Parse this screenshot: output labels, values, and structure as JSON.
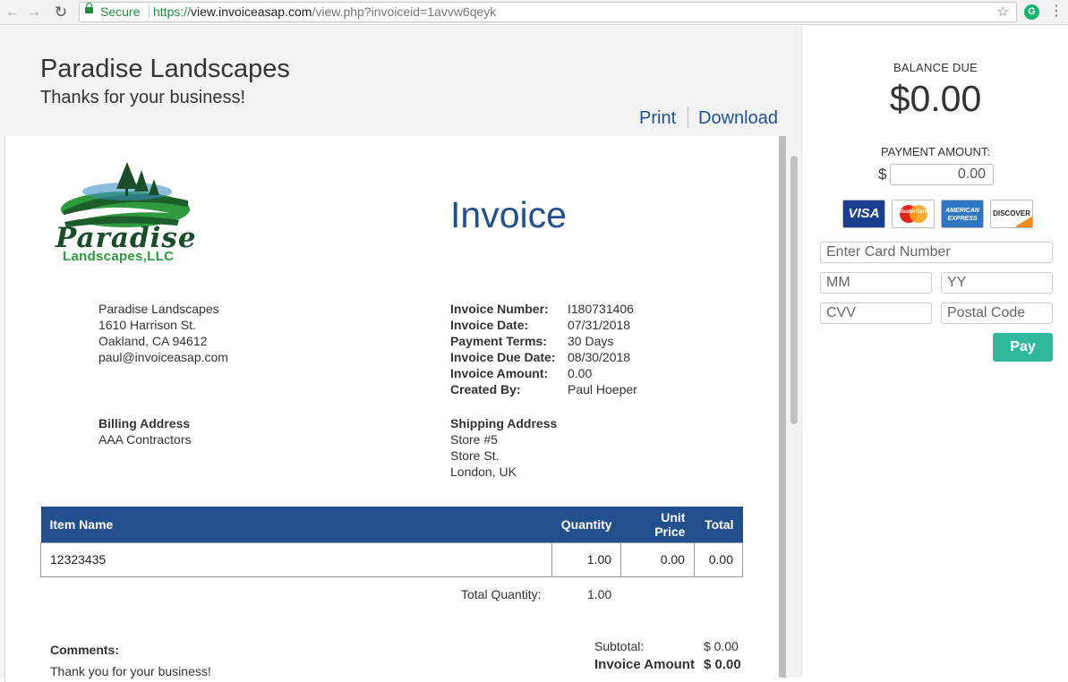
{
  "browser": {
    "secure_label": "Secure",
    "url_scheme": "https://",
    "url_host": "view.invoiceasap.com",
    "url_path": "/view.php?invoiceid=1avvw6qeyk",
    "extension_letter": "G"
  },
  "header": {
    "business_name": "Paradise Landscapes",
    "thanks": "Thanks for your business!",
    "print_label": "Print",
    "download_label": "Download"
  },
  "logo": {
    "line1": "Paradise",
    "line2": "Landscapes,LLC"
  },
  "invoice": {
    "title": "Invoice",
    "from": [
      "Paradise Landscapes",
      "1610 Harrison St.",
      "Oakland, CA 94612",
      "paul@invoiceasap.com"
    ],
    "meta": [
      {
        "label": "Invoice Number:",
        "value": "I180731406"
      },
      {
        "label": "Invoice Date:",
        "value": "07/31/2018"
      },
      {
        "label": "Payment Terms:",
        "value": "30 Days"
      },
      {
        "label": "Invoice Due Date:",
        "value": "08/30/2018"
      },
      {
        "label": "Invoice Amount:",
        "value": "0.00"
      },
      {
        "label": "Created By:",
        "value": "Paul Hoeper"
      }
    ],
    "billing": {
      "title": "Billing Address",
      "lines": [
        "AAA Contractors"
      ]
    },
    "shipping": {
      "title": "Shipping Address",
      "lines": [
        "Store #5",
        "Store St.",
        "London, UK"
      ]
    },
    "table": {
      "headers": {
        "item": "Item Name",
        "qty": "Quantity",
        "price": "Unit Price",
        "total": "Total"
      },
      "rows": [
        {
          "item": "12323435",
          "qty": "1.00",
          "price": "0.00",
          "total": "0.00"
        }
      ]
    },
    "total_quantity_label": "Total Quantity:",
    "total_quantity": "1.00",
    "comments_label": "Comments:",
    "comments": "Thank you for your business!",
    "subtotal_label": "Subtotal:",
    "subtotal": "$ 0.00",
    "amount_label": "Invoice Amount",
    "amount": "$ 0.00"
  },
  "payment": {
    "balance_label": "BALANCE DUE",
    "balance": "$0.00",
    "amount_label": "PAYMENT AMOUNT:",
    "currency": "$",
    "amount_value": "0.00",
    "cards": {
      "visa": "VISA",
      "mastercard": "MasterCard",
      "amex": "AMERICAN EXPRESS",
      "discover": "DISCOVER"
    },
    "card_placeholder": "Enter Card Number",
    "mm_placeholder": "MM",
    "yy_placeholder": "YY",
    "cvv_placeholder": "CVV",
    "zip_placeholder": "Postal Code",
    "pay_label": "Pay"
  }
}
